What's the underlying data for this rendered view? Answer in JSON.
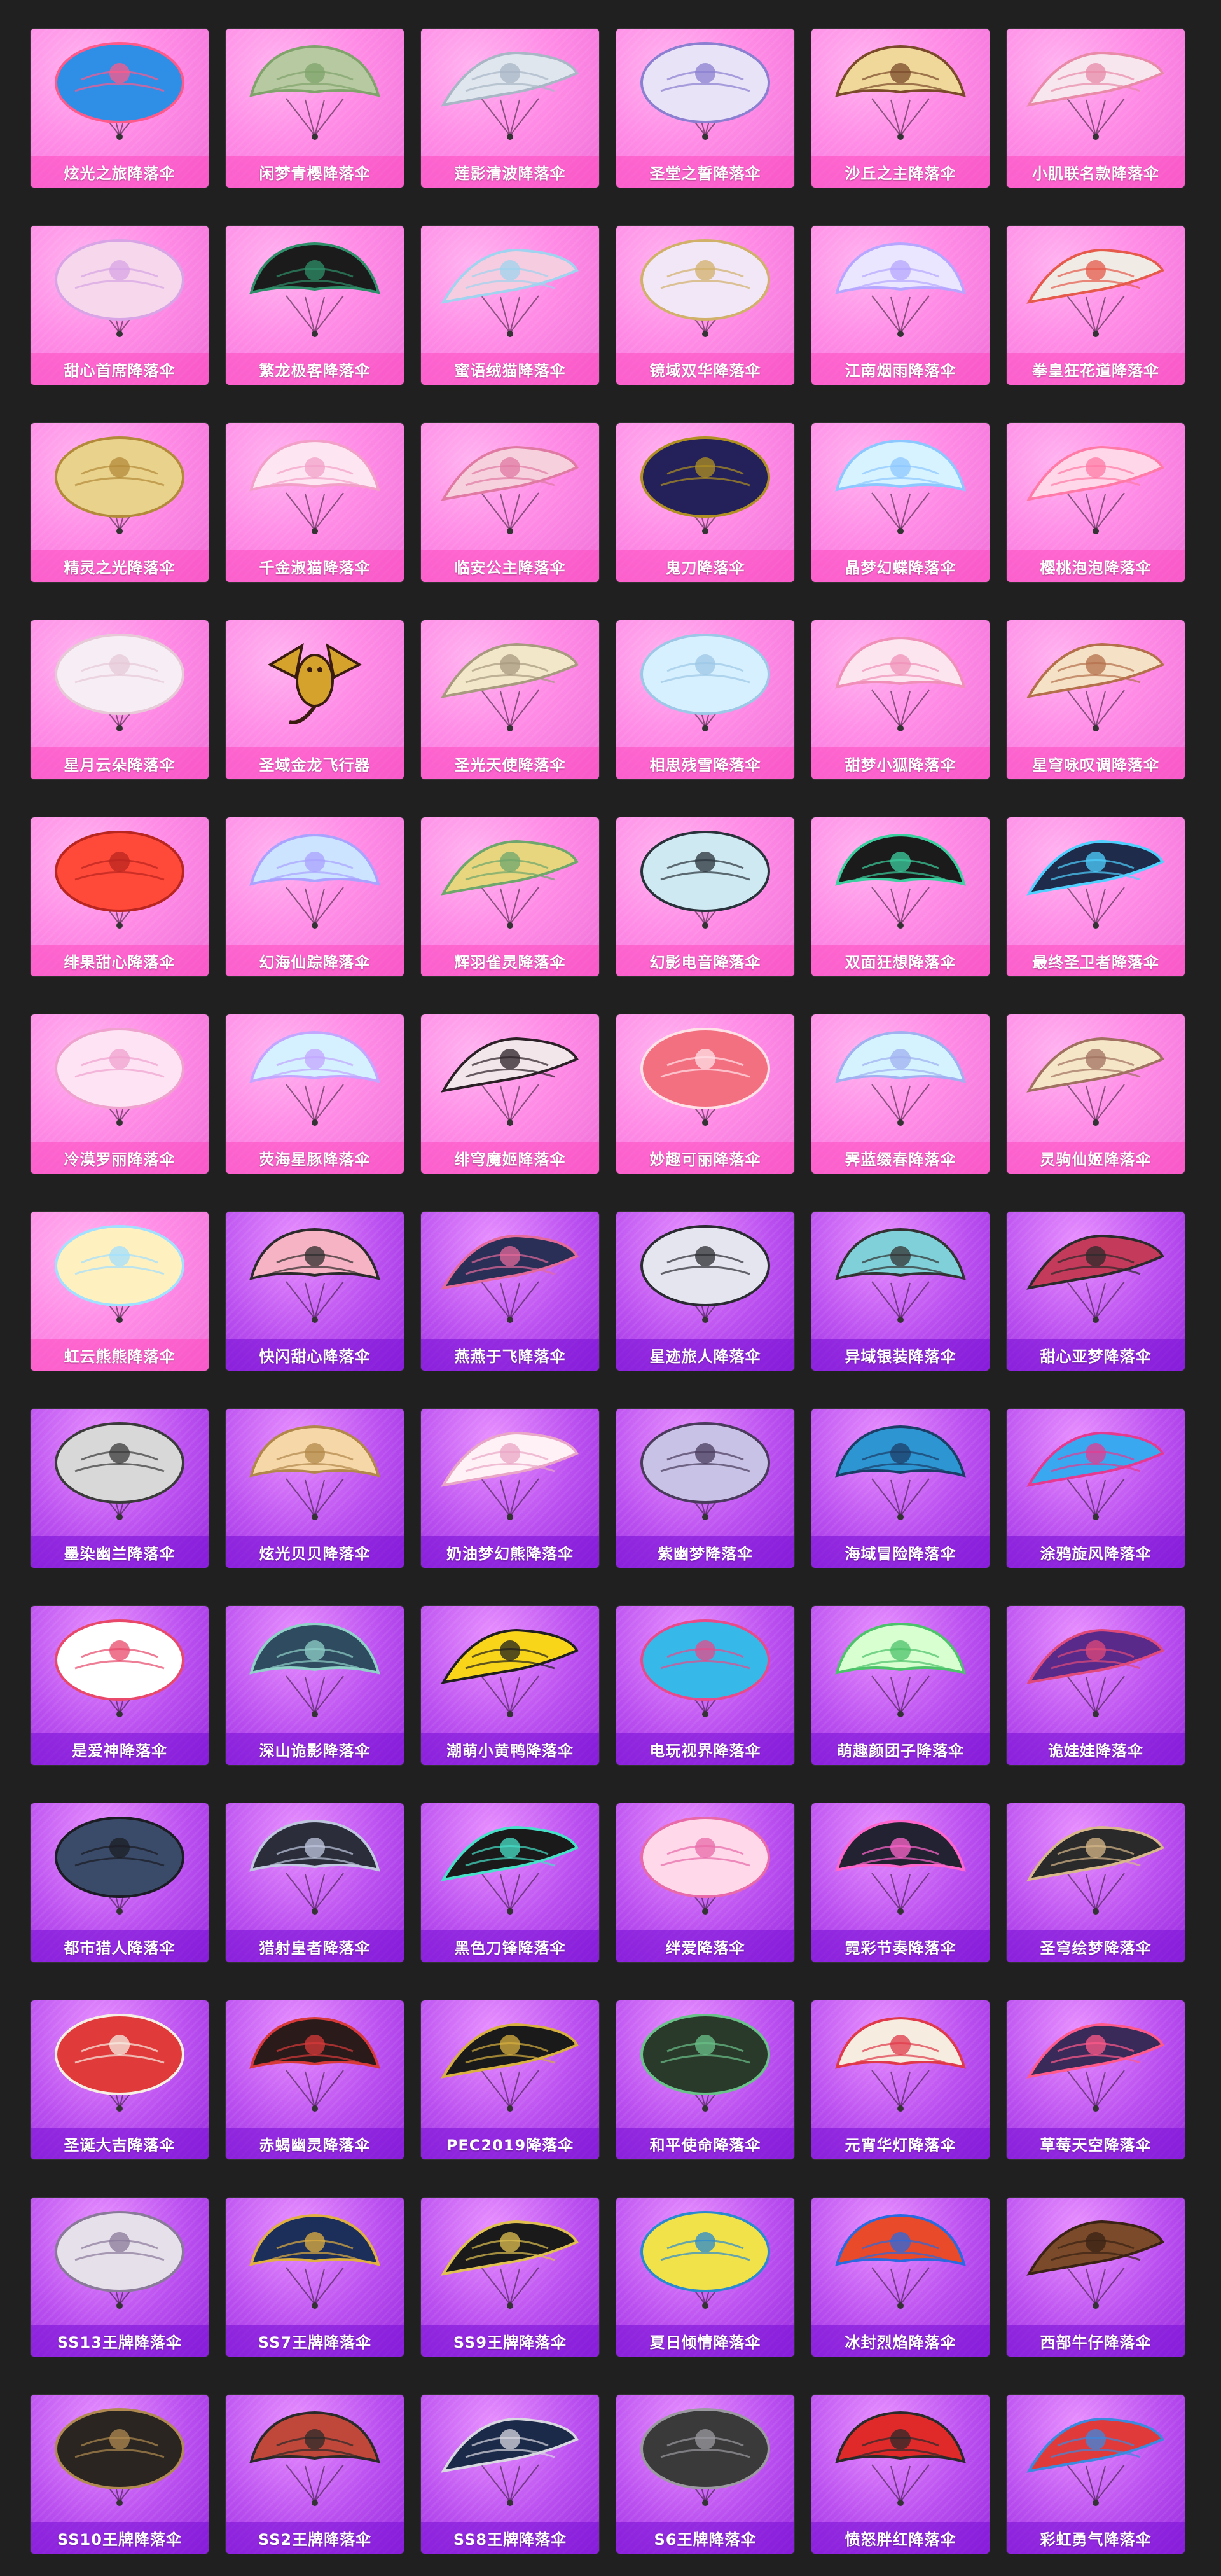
{
  "items": [
    {
      "name": "炫光之旅降落伞",
      "icon": "parachute-icon",
      "colors": [
        "#2f8ee6",
        "#ff5a8a"
      ],
      "theme": "pink"
    },
    {
      "name": "闲梦青樱降落伞",
      "icon": "parachute-icon",
      "colors": [
        "#b7c9a0",
        "#7fa36b"
      ],
      "theme": "pink"
    },
    {
      "name": "莲影清波降落伞",
      "icon": "parachute-icon",
      "colors": [
        "#dfe6ee",
        "#a9b6c6"
      ],
      "theme": "pink"
    },
    {
      "name": "圣堂之誓降落伞",
      "icon": "parachute-icon",
      "colors": [
        "#e9e3f7",
        "#8a7fd0"
      ],
      "theme": "pink"
    },
    {
      "name": "沙丘之主降落伞",
      "icon": "parachute-icon",
      "colors": [
        "#f0d89a",
        "#7a4a2a"
      ],
      "theme": "pink"
    },
    {
      "name": "小肌联名款降落伞",
      "icon": "parachute-icon",
      "colors": [
        "#f7e6ee",
        "#e88aa8"
      ],
      "theme": "pink"
    },
    {
      "name": "甜心首席降落伞",
      "icon": "parachute-icon",
      "colors": [
        "#f6d7ec",
        "#d8a4e6"
      ],
      "theme": "pink"
    },
    {
      "name": "繁龙极客降落伞",
      "icon": "parachute-icon",
      "colors": [
        "#1b1b1b",
        "#2e8f6a"
      ],
      "theme": "pink"
    },
    {
      "name": "蜜语绒猫降落伞",
      "icon": "parachute-icon",
      "colors": [
        "#f6cde0",
        "#9fd3ef"
      ],
      "theme": "pink"
    },
    {
      "name": "镜域双华降落伞",
      "icon": "parachute-icon",
      "colors": [
        "#f1e7f6",
        "#d1b069"
      ],
      "theme": "pink"
    },
    {
      "name": "江南烟雨降落伞",
      "icon": "parachute-icon",
      "colors": [
        "#eae6ff",
        "#b6a6ff"
      ],
      "theme": "pink"
    },
    {
      "name": "拳皇狂花道降落伞",
      "icon": "parachute-icon",
      "colors": [
        "#f0ece5",
        "#e55a4b"
      ],
      "theme": "pink"
    },
    {
      "name": "精灵之光降落伞",
      "icon": "parachute-icon",
      "colors": [
        "#e9d28b",
        "#b38a3a"
      ],
      "theme": "pink"
    },
    {
      "name": "千金淑猫降落伞",
      "icon": "parachute-icon",
      "colors": [
        "#fde6f1",
        "#f2a0c8"
      ],
      "theme": "pink"
    },
    {
      "name": "临安公主降落伞",
      "icon": "parachute-icon",
      "colors": [
        "#f6d0dd",
        "#e07aa3"
      ],
      "theme": "pink"
    },
    {
      "name": "鬼刀降落伞",
      "icon": "parachute-icon",
      "colors": [
        "#24215a",
        "#b09020"
      ],
      "theme": "pink"
    },
    {
      "name": "晶梦幻蝶降落伞",
      "icon": "parachute-icon",
      "colors": [
        "#d7f3ff",
        "#8cc7ff"
      ],
      "theme": "pink"
    },
    {
      "name": "樱桃泡泡降落伞",
      "icon": "parachute-icon",
      "colors": [
        "#ffd7e8",
        "#ff7aa6"
      ],
      "theme": "pink"
    },
    {
      "name": "星月云朵降落伞",
      "icon": "parachute-icon",
      "colors": [
        "#f7eef5",
        "#e6c8d7"
      ],
      "theme": "pink"
    },
    {
      "name": "圣域金龙飞行器",
      "icon": "dragon-glider-icon",
      "colors": [
        "#d5a22b",
        "#3a1b10"
      ],
      "theme": "pink"
    },
    {
      "name": "圣光天使降落伞",
      "icon": "parachute-icon",
      "colors": [
        "#f3e7c9",
        "#a79a7f"
      ],
      "theme": "pink"
    },
    {
      "name": "相思残雪降落伞",
      "icon": "parachute-icon",
      "colors": [
        "#d6f0ff",
        "#9dc7e6"
      ],
      "theme": "pink"
    },
    {
      "name": "甜梦小狐降落伞",
      "icon": "parachute-icon",
      "colors": [
        "#fde5f0",
        "#f090b8"
      ],
      "theme": "pink"
    },
    {
      "name": "星穹咏叹调降落伞",
      "icon": "parachute-icon",
      "colors": [
        "#f5e1c5",
        "#b46f4b"
      ],
      "theme": "pink"
    },
    {
      "name": "绯果甜心降落伞",
      "icon": "parachute-icon",
      "colors": [
        "#ff4a3a",
        "#b9251f"
      ],
      "theme": "pink"
    },
    {
      "name": "幻海仙踪降落伞",
      "icon": "parachute-icon",
      "colors": [
        "#cce4ff",
        "#a9a2ff"
      ],
      "theme": "pink"
    },
    {
      "name": "辉羽雀灵降落伞",
      "icon": "parachute-icon",
      "colors": [
        "#e8d67f",
        "#6ea66c"
      ],
      "theme": "pink"
    },
    {
      "name": "幻影电音降落伞",
      "icon": "parachute-icon",
      "colors": [
        "#cfe9f3",
        "#29323a"
      ],
      "theme": "pink"
    },
    {
      "name": "双面狂想降落伞",
      "icon": "parachute-icon",
      "colors": [
        "#1b1b1b",
        "#3ccf9f"
      ],
      "theme": "pink"
    },
    {
      "name": "最终圣卫者降落伞",
      "icon": "parachute-icon",
      "colors": [
        "#1e2b4b",
        "#4fd0ff"
      ],
      "theme": "pink"
    },
    {
      "name": "冷漠罗丽降落伞",
      "icon": "parachute-icon",
      "colors": [
        "#fde3f3",
        "#f0a2cf"
      ],
      "theme": "pink"
    },
    {
      "name": "荧海星豚降落伞",
      "icon": "parachute-icon",
      "colors": [
        "#d5f0ff",
        "#c2a6ff"
      ],
      "theme": "pink"
    },
    {
      "name": "绯穹魔姬降落伞",
      "icon": "parachute-icon",
      "colors": [
        "#f2e6ea",
        "#2b2026"
      ],
      "theme": "pink"
    },
    {
      "name": "妙趣可丽降落伞",
      "icon": "parachute-icon",
      "colors": [
        "#f27080",
        "#ffe2e8"
      ],
      "theme": "pink"
    },
    {
      "name": "霁蓝缀春降落伞",
      "icon": "parachute-icon",
      "colors": [
        "#d4f3ff",
        "#a0b0f0"
      ],
      "theme": "pink"
    },
    {
      "name": "灵驹仙姬降落伞",
      "icon": "parachute-icon",
      "colors": [
        "#f5e6c7",
        "#a07060"
      ],
      "theme": "pink"
    },
    {
      "name": "虹云熊熊降落伞",
      "icon": "parachute-icon",
      "colors": [
        "#fff0c0",
        "#a2e0ff"
      ],
      "theme": "pink"
    },
    {
      "name": "快闪甜心降落伞",
      "icon": "parachute-icon",
      "colors": [
        "#f6b3c3",
        "#2b2b2b"
      ],
      "theme": "purple"
    },
    {
      "name": "燕燕于飞降落伞",
      "icon": "parachute-icon",
      "colors": [
        "#2a2f57",
        "#e46a9a"
      ],
      "theme": "purple"
    },
    {
      "name": "星迹旅人降落伞",
      "icon": "parachute-icon",
      "colors": [
        "#e5e5f0",
        "#2b2b32"
      ],
      "theme": "purple"
    },
    {
      "name": "异域银装降落伞",
      "icon": "parachute-icon",
      "colors": [
        "#7fd0d8",
        "#333333"
      ],
      "theme": "purple"
    },
    {
      "name": "甜心亚梦降落伞",
      "icon": "parachute-icon",
      "colors": [
        "#c43a5a",
        "#2b2b2b"
      ],
      "theme": "purple"
    },
    {
      "name": "墨染幽兰降落伞",
      "icon": "parachute-icon",
      "colors": [
        "#d8d8d8",
        "#3a3a3a"
      ],
      "theme": "purple"
    },
    {
      "name": "炫光贝贝降落伞",
      "icon": "parachute-icon",
      "colors": [
        "#f6d7a8",
        "#b1884a"
      ],
      "theme": "purple"
    },
    {
      "name": "奶油梦幻熊降落伞",
      "icon": "parachute-icon",
      "colors": [
        "#fff1f6",
        "#e9a6c6"
      ],
      "theme": "purple"
    },
    {
      "name": "紫幽梦降落伞",
      "icon": "parachute-icon",
      "colors": [
        "#c8c2e6",
        "#4a3b5c"
      ],
      "theme": "purple"
    },
    {
      "name": "海域冒险降落伞",
      "icon": "parachute-icon",
      "colors": [
        "#2c95d2",
        "#1c3d66"
      ],
      "theme": "purple"
    },
    {
      "name": "涂鸦旋风降落伞",
      "icon": "parachute-icon",
      "colors": [
        "#39a8f0",
        "#e53a8f"
      ],
      "theme": "purple"
    },
    {
      "name": "是爱神降落伞",
      "icon": "parachute-icon",
      "colors": [
        "#ffffff",
        "#e8486a"
      ],
      "theme": "purple"
    },
    {
      "name": "深山诡影降落伞",
      "icon": "parachute-icon",
      "colors": [
        "#2e4b5f",
        "#8fd0c8"
      ],
      "theme": "purple"
    },
    {
      "name": "潮萌小黄鸭降落伞",
      "icon": "parachute-icon",
      "colors": [
        "#f9d51a",
        "#1f1f1f"
      ],
      "theme": "purple"
    },
    {
      "name": "电玩视界降落伞",
      "icon": "parachute-icon",
      "colors": [
        "#36b8e8",
        "#e84a8a"
      ],
      "theme": "purple"
    },
    {
      "name": "萌趣颜团子降落伞",
      "icon": "parachute-icon",
      "colors": [
        "#d8ffd0",
        "#4cc26a"
      ],
      "theme": "purple"
    },
    {
      "name": "诡娃娃降落伞",
      "icon": "parachute-icon",
      "colors": [
        "#5a2a8a",
        "#e04a7a"
      ],
      "theme": "purple"
    },
    {
      "name": "都市猎人降落伞",
      "icon": "parachute-icon",
      "colors": [
        "#3a4b6a",
        "#1c1c24"
      ],
      "theme": "purple"
    },
    {
      "name": "猎射皇者降落伞",
      "icon": "parachute-icon",
      "colors": [
        "#2b2e3a",
        "#c0c8e0"
      ],
      "theme": "purple"
    },
    {
      "name": "黑色刀锋降落伞",
      "icon": "parachute-icon",
      "colors": [
        "#1a1a1a",
        "#47e0c8"
      ],
      "theme": "purple"
    },
    {
      "name": "绊爱降落伞",
      "icon": "parachute-icon",
      "colors": [
        "#ffd9ea",
        "#e86aa8"
      ],
      "theme": "purple"
    },
    {
      "name": "霓彩节奏降落伞",
      "icon": "parachute-icon",
      "colors": [
        "#222233",
        "#ff66cc"
      ],
      "theme": "purple"
    },
    {
      "name": "圣穹绘梦降落伞",
      "icon": "parachute-icon",
      "colors": [
        "#2a2a2a",
        "#d8b88a"
      ],
      "theme": "purple"
    },
    {
      "name": "圣诞大吉降落伞",
      "icon": "parachute-icon",
      "colors": [
        "#e03a3a",
        "#f6efe4"
      ],
      "theme": "purple"
    },
    {
      "name": "赤蝎幽灵降落伞",
      "icon": "parachute-icon",
      "colors": [
        "#2a1a1a",
        "#d83a3a"
      ],
      "theme": "purple"
    },
    {
      "name": "PEC2019降落伞",
      "icon": "parachute-icon",
      "colors": [
        "#1a1a1a",
        "#d8b040"
      ],
      "theme": "purple"
    },
    {
      "name": "和平使命降落伞",
      "icon": "parachute-icon",
      "colors": [
        "#2a3a2a",
        "#6ac28a"
      ],
      "theme": "purple"
    },
    {
      "name": "元宵华灯降落伞",
      "icon": "parachute-icon",
      "colors": [
        "#f6ece0",
        "#e03a4a"
      ],
      "theme": "purple"
    },
    {
      "name": "草莓天空降落伞",
      "icon": "parachute-icon",
      "colors": [
        "#3a2a5a",
        "#ff5a8a"
      ],
      "theme": "purple"
    },
    {
      "name": "SS13王牌降落伞",
      "icon": "parachute-icon",
      "colors": [
        "#e6e0ea",
        "#8a7a9a"
      ],
      "theme": "purple"
    },
    {
      "name": "SS7王牌降落伞",
      "icon": "parachute-icon",
      "colors": [
        "#1c2e5a",
        "#e0b040"
      ],
      "theme": "purple"
    },
    {
      "name": "SS9王牌降落伞",
      "icon": "parachute-icon",
      "colors": [
        "#1a1a1a",
        "#e0c050"
      ],
      "theme": "purple"
    },
    {
      "name": "夏日倾情降落伞",
      "icon": "parachute-icon",
      "colors": [
        "#f2e24a",
        "#2a8ad0"
      ],
      "theme": "purple"
    },
    {
      "name": "冰封烈焰降落伞",
      "icon": "parachute-icon",
      "colors": [
        "#e84a2a",
        "#2a6ae0"
      ],
      "theme": "purple"
    },
    {
      "name": "西部牛仔降落伞",
      "icon": "parachute-icon",
      "colors": [
        "#7a4a2a",
        "#3a2214"
      ],
      "theme": "purple"
    },
    {
      "name": "SS10王牌降落伞",
      "icon": "parachute-icon",
      "colors": [
        "#2a2520",
        "#b08a50"
      ],
      "theme": "purple"
    },
    {
      "name": "SS2王牌降落伞",
      "icon": "parachute-icon",
      "colors": [
        "#c0483a",
        "#2a2a2a"
      ],
      "theme": "purple"
    },
    {
      "name": "SS8王牌降落伞",
      "icon": "parachute-icon",
      "colors": [
        "#1c2a4a",
        "#d8d8e0"
      ],
      "theme": "purple"
    },
    {
      "name": "S6王牌降落伞",
      "icon": "parachute-icon",
      "colors": [
        "#3a3a3a",
        "#9a9aa0"
      ],
      "theme": "purple"
    },
    {
      "name": "愤怒胖红降落伞",
      "icon": "parachute-icon",
      "colors": [
        "#e02a2a",
        "#2a2a2a"
      ],
      "theme": "purple"
    },
    {
      "name": "彩虹勇气降落伞",
      "icon": "parachute-icon",
      "colors": [
        "#e03a3a",
        "#3a8ae0"
      ],
      "theme": "purple"
    }
  ]
}
